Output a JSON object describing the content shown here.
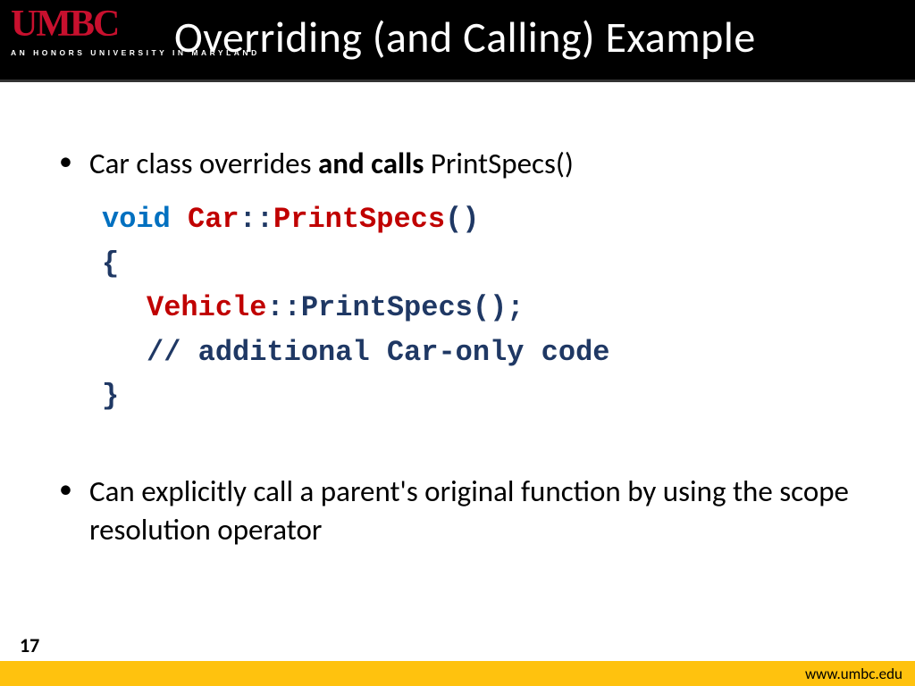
{
  "header": {
    "logo_main": "UMBC",
    "logo_sub": "AN HONORS UNIVERSITY IN MARYLAND",
    "title": "Overriding (and Calling) Example"
  },
  "bullets": {
    "b1_pre": "Car class overrides ",
    "b1_bold": "and calls",
    "b1_post": " PrintSpecs()",
    "b2": "Can explicitly call a parent's original function by using the scope resolution operator"
  },
  "code": {
    "l1_void": "void",
    "l1_sp1": " ",
    "l1_car": "Car",
    "l1_scope": "::",
    "l1_fn": "PrintSpecs",
    "l1_paren": "()",
    "l2": "{",
    "l3_vehicle": "Vehicle",
    "l3_rest": "::PrintSpecs();",
    "l4": "// additional Car-only code",
    "l5": "}"
  },
  "footer": {
    "page": "17",
    "url": "www.umbc.edu"
  }
}
